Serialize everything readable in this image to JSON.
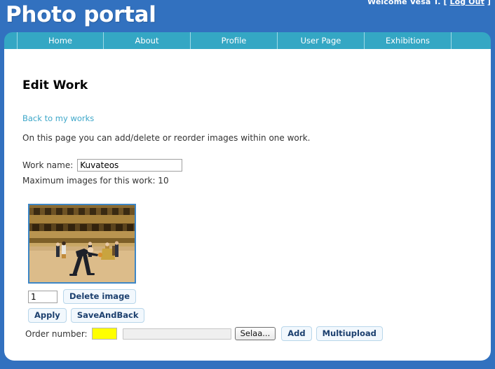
{
  "header": {
    "site_title": "Photo portal",
    "welcome_prefix": "Welcome ",
    "welcome_user": "Vesa T.",
    "bracket_open": " [ ",
    "logout_label": "Log Out",
    "bracket_close": " ]",
    "bg_color": "#3271bf"
  },
  "nav": {
    "bg_color": "#34a7c4",
    "tabs": [
      {
        "label": "Home"
      },
      {
        "label": "About"
      },
      {
        "label": "Profile"
      },
      {
        "label": "User Page"
      },
      {
        "label": "Exhibitions"
      }
    ]
  },
  "main": {
    "page_title": "Edit Work",
    "back_link": "Back to my works",
    "intro_text": "On this page you can add/delete or reorder images within one work.",
    "work_name_label": "Work name:",
    "work_name_value": "Kuvateos",
    "max_images_text": "Maximum images for this work: 10",
    "link_color": "#3da7c9"
  },
  "image_item": {
    "order_index_value": "1",
    "delete_label": "Delete image",
    "alt_description": "Photo of people in a bullring arena, one person bending forward"
  },
  "actions": {
    "apply_label": "Apply",
    "save_and_back_label": "SaveAndBack"
  },
  "upload": {
    "order_number_label": "Order number:",
    "order_number_value": "",
    "order_number_bg": "#ffff00",
    "file_value": "",
    "browse_label": "Selaa...",
    "add_label": "Add",
    "multiupload_label": "Multiupload"
  }
}
